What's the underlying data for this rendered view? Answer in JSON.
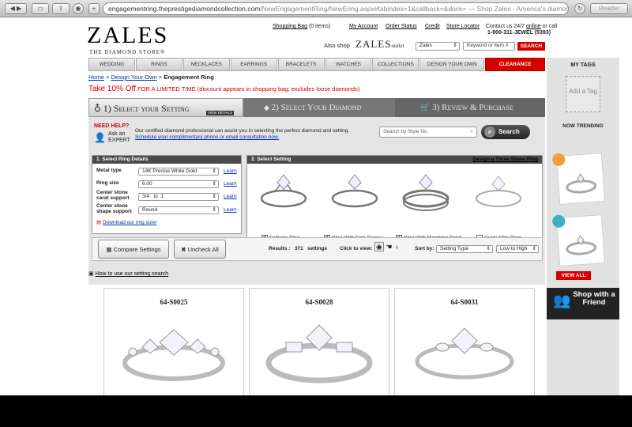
{
  "browser": {
    "url_main": "engagementring.theprestigediamondcollection.com",
    "url_rest": "/NewEngagementRing/NewEring.aspx#tabindex=1&callback=&dock=",
    "tab_title": " — Shop Zales - America's diamond ...",
    "reader_label": "Reader"
  },
  "header": {
    "logo": "ZALES",
    "tagline": "THE DIAMOND STORE®",
    "shopping_bag": "Shopping Bag",
    "bag_count": "(0 items)",
    "my_account": "My Account",
    "order_status": "Order Status",
    "credit": "Credit",
    "store_locator": "Store Locator",
    "contact_prefix": "Contact us 24/7",
    "contact_online": "online",
    "contact_suffix": "or call",
    "phone": "1-800-311-JEWEL (5393)",
    "also_shop": "Also shop",
    "outlet_logo": "ZALES",
    "outlet_word": "outlet",
    "store_select": "Zales",
    "search_placeholder": "Keyword or item #",
    "search_button": "SEARCH"
  },
  "nav": [
    "WEDDING",
    "RINGS",
    "NECKLACES",
    "EARRINGS",
    "BRACELETS",
    "WATCHES",
    "COLLECTIONS",
    "DESIGN YOUR OWN",
    "CLEARANCE"
  ],
  "breadcrumb": {
    "home": "Home",
    "design": "Design Your Own",
    "current": "Engagement Ring"
  },
  "promo": {
    "main": "Take 10% Off",
    "detail": "FOR A LIMITED TIME (discount appears in shopping bag; excludes loose diamonds)"
  },
  "steps": [
    "1) Select your Setting",
    "2) Select Your Diamond",
    "3) Review & Purchase"
  ],
  "view_details": "VIEW DETAILS",
  "help": {
    "need_help": "NEED HELP?",
    "ask": "Ask an",
    "expert": "EXPERT",
    "text": "Our certified diamond professional can assist you in selecting the perfect diamond and setting.",
    "link": "Schedule your complimentary phone or email consultation now."
  },
  "style_search": {
    "placeholder": "Search by Style No",
    "button": "Search"
  },
  "ring_details": {
    "title": "1. Select Ring Details",
    "rows": [
      {
        "label": "Metal type",
        "value": "14K Precise White Gold",
        "learn": "Learn"
      },
      {
        "label": "Ring size",
        "value": "6.00",
        "learn": "Learn"
      },
      {
        "label": "Center stone carat support",
        "value": "3/4   to  1",
        "learn": "Learn"
      },
      {
        "label": "Center stone shape support",
        "value": "Round",
        "learn": "Learn"
      }
    ],
    "sizer": "Download our ring sizer"
  },
  "settings": {
    "title": "2. Select Setting",
    "three_stone": "Design a Three Stone Ring",
    "options": [
      {
        "label": "Solitaire Ring",
        "checked": true
      },
      {
        "label": "Ring With Side Stones",
        "checked": true
      },
      {
        "label": "Ring With Matching Band",
        "checked": true
      },
      {
        "label": "Quick Ship Ring",
        "checked": false
      }
    ]
  },
  "toolbar": {
    "compare": "Compare Settings",
    "uncheck": "Uncheck All",
    "results_label": "Results :",
    "results_count": "371",
    "results_unit": "settings",
    "click_view": "Click to view:",
    "sort_label": "Sort by:",
    "sort_value": "Setting Type",
    "order_value": "Low to High"
  },
  "how_to": "How to use our setting search",
  "products": [
    {
      "sku": "64-S0025"
    },
    {
      "sku": "64-S0028"
    },
    {
      "sku": "64-S0031"
    }
  ],
  "sidebar": {
    "my_tags": "MY TAGS",
    "add_tag": "Add a Tag",
    "now_trending": "NOW TRENDING",
    "view_all": "VIEW ALL",
    "shop_with": "Shop with a Friend"
  }
}
